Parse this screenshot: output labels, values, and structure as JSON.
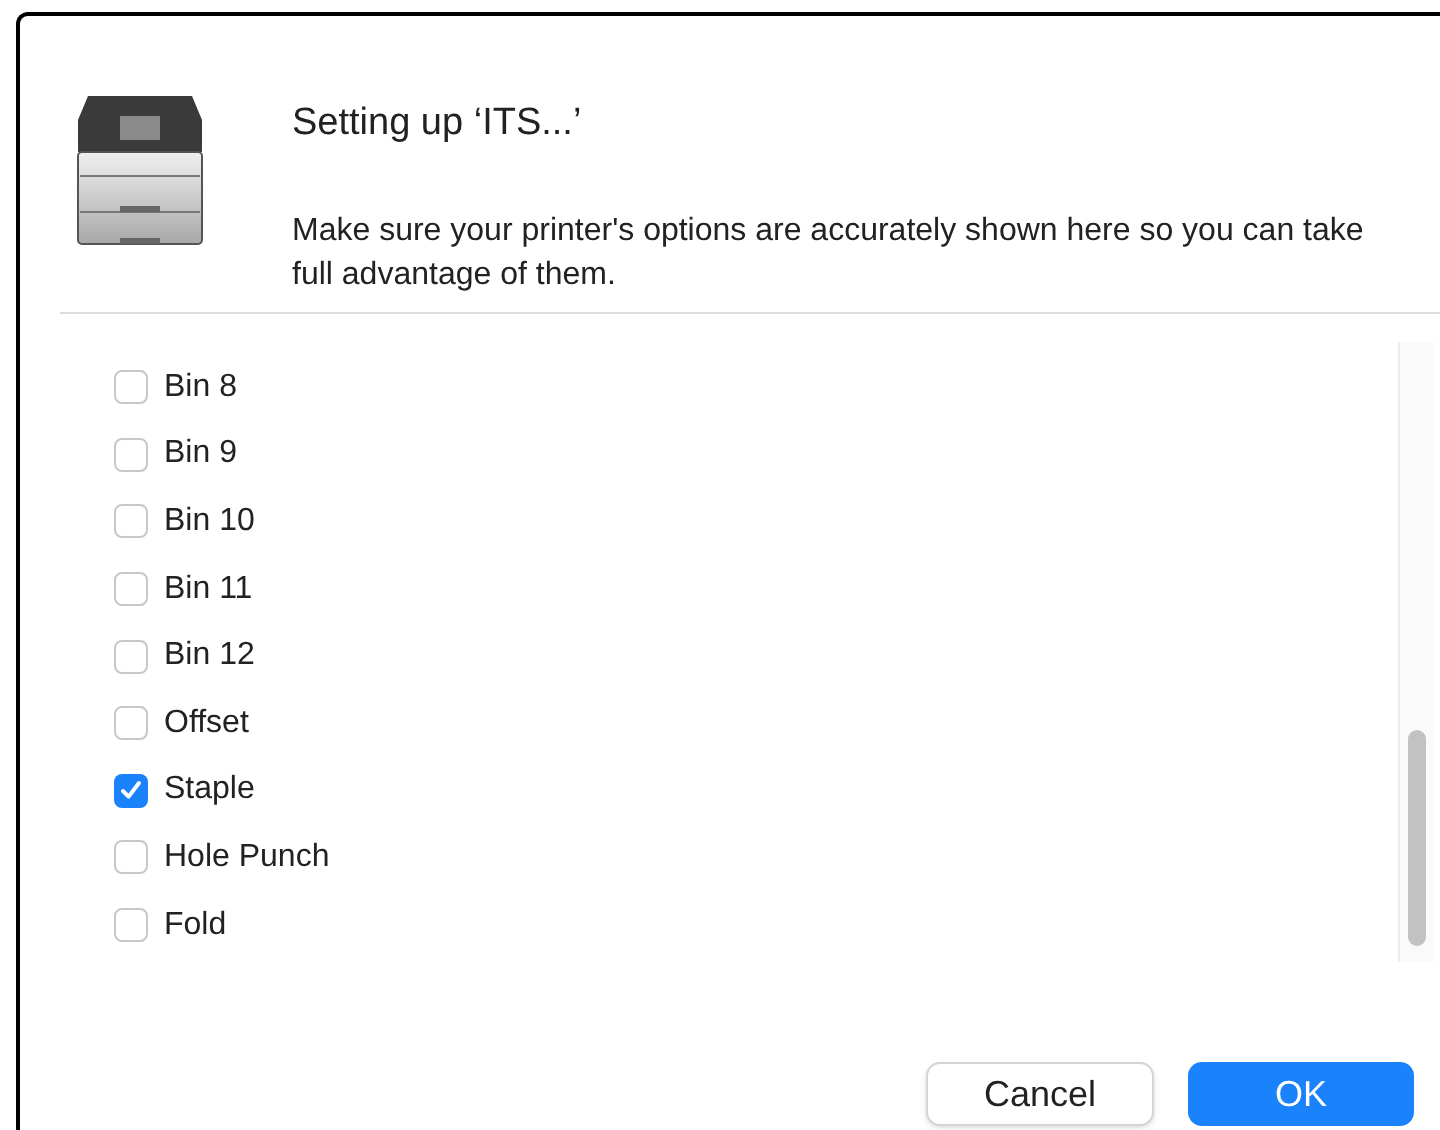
{
  "dialog": {
    "title": "Setting up ‘ITS...’",
    "message": "Make sure your printer's options are accurately shown here so you can take full advantage of them."
  },
  "options": [
    {
      "label": "Bin 8",
      "checked": false
    },
    {
      "label": "Bin 9",
      "checked": false
    },
    {
      "label": "Bin 10",
      "checked": false
    },
    {
      "label": "Bin 11",
      "checked": false
    },
    {
      "label": "Bin 12",
      "checked": false
    },
    {
      "label": "Offset",
      "checked": false
    },
    {
      "label": "Staple",
      "checked": true
    },
    {
      "label": "Hole Punch",
      "checked": false
    },
    {
      "label": "Fold",
      "checked": false
    }
  ],
  "buttons": [
    {
      "label": "Cancel",
      "kind": "secondary"
    },
    {
      "label": "OK",
      "kind": "primary"
    }
  ]
}
